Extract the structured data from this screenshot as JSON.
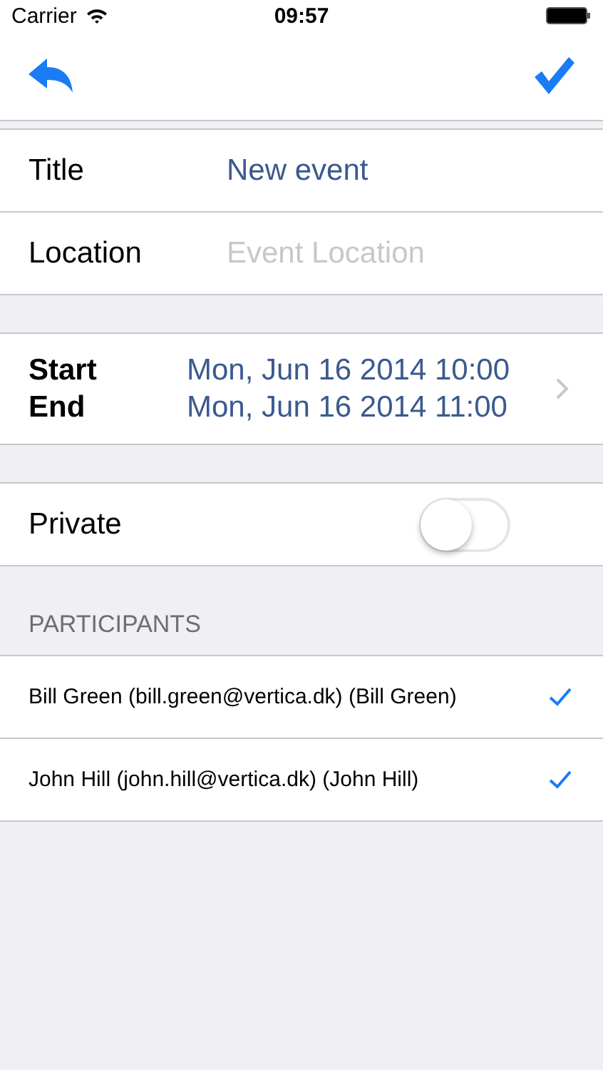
{
  "status_bar": {
    "carrier": "Carrier",
    "time": "09:57"
  },
  "fields": [
    {
      "label": "Title",
      "value": "New event"
    },
    {
      "label": "Location",
      "placeholder": "Event Location"
    }
  ],
  "dates": {
    "start_label": "Start",
    "end_label": "End",
    "start": "Mon, Jun 16 2014 10:00",
    "end": "Mon, Jun 16 2014 11:00"
  },
  "private": {
    "label": "Private",
    "on": false
  },
  "participants": {
    "header": "PARTICIPANTS",
    "items": [
      {
        "name": "Bill Green (bill.green@vertica.dk) (Bill Green)",
        "checked": true
      },
      {
        "name": "John Hill (john.hill@vertica.dk) (John Hill)",
        "checked": true
      }
    ]
  }
}
